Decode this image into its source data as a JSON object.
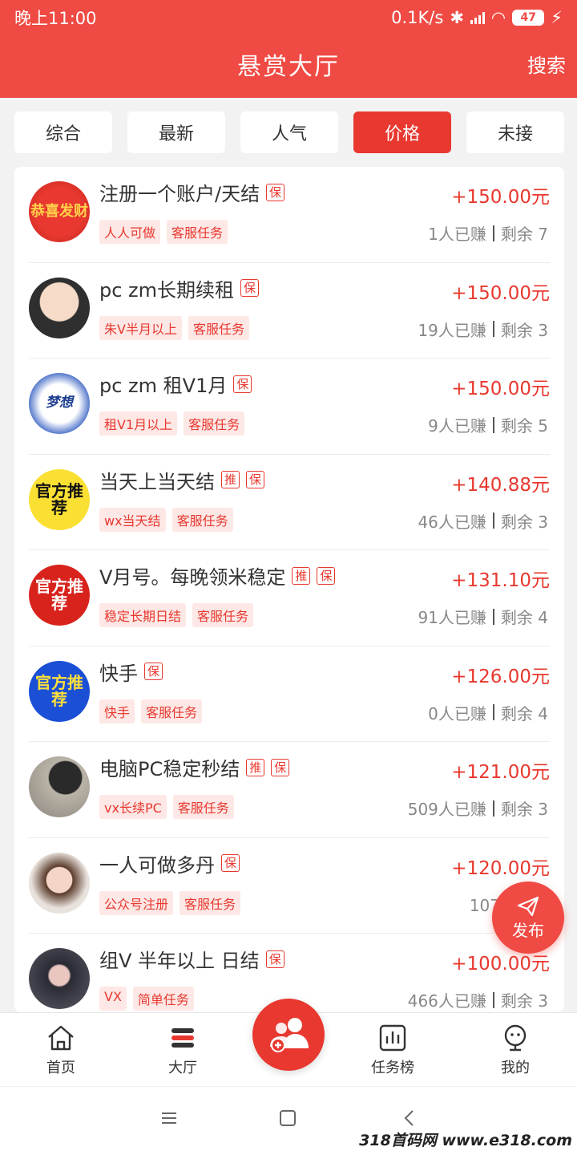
{
  "status": {
    "time": "晚上11:00",
    "speed": "0.1K/s",
    "battery": "47"
  },
  "header": {
    "title": "悬赏大厅",
    "search_label": "搜索",
    "accent": "#ef4a43"
  },
  "tabs": [
    {
      "label": "综合",
      "active": false
    },
    {
      "label": "最新",
      "active": false
    },
    {
      "label": "人气",
      "active": false
    },
    {
      "label": "价格",
      "active": true
    },
    {
      "label": "未接",
      "active": false
    }
  ],
  "tasks": [
    {
      "title": "注册一个账户/天结",
      "badges": [
        "保"
      ],
      "price": "+150.00元",
      "tags": [
        "人人可做",
        "客服任务"
      ],
      "earned": "1人已赚",
      "remaining": "剩余 7",
      "avatar_text": "恭喜发财",
      "avatar_style": "lucky"
    },
    {
      "title": "pc zm长期续租",
      "badges": [
        "保"
      ],
      "price": "+150.00元",
      "tags": [
        "朱V半月以上",
        "客服任务"
      ],
      "earned": "19人已赚",
      "remaining": "剩余 3",
      "avatar_text": "",
      "avatar_style": "anime"
    },
    {
      "title": "pc zm 租V1月",
      "badges": [
        "保"
      ],
      "price": "+150.00元",
      "tags": [
        "租V1月以上",
        "客服任务"
      ],
      "earned": "9人已赚",
      "remaining": "剩余 5",
      "avatar_text": "梦想",
      "avatar_style": "dream"
    },
    {
      "title": "当天上当天结",
      "badges": [
        "推",
        "保"
      ],
      "price": "+140.88元",
      "tags": [
        "wx当天结",
        "客服任务"
      ],
      "earned": "46人已赚",
      "remaining": "剩余 3",
      "avatar_text": "官方推荐",
      "avatar_style": "official-yellow"
    },
    {
      "title": "V月号。每晚领米稳定",
      "badges": [
        "推",
        "保"
      ],
      "price": "+131.10元",
      "tags": [
        "稳定长期日结",
        "客服任务"
      ],
      "earned": "91人已赚",
      "remaining": "剩余 4",
      "avatar_text": "官方推荐",
      "avatar_style": "official-red"
    },
    {
      "title": "快手",
      "badges": [
        "保"
      ],
      "price": "+126.00元",
      "tags": [
        "快手",
        "客服任务"
      ],
      "earned": "0人已赚",
      "remaining": "剩余 4",
      "avatar_text": "官方推荐",
      "avatar_style": "official-blue"
    },
    {
      "title": "电脑PC稳定秒结",
      "badges": [
        "推",
        "保"
      ],
      "price": "+121.00元",
      "tags": [
        "vx长续PC",
        "客服任务"
      ],
      "earned": "509人已赚",
      "remaining": "剩余 3",
      "avatar_text": "",
      "avatar_style": "photo-man"
    },
    {
      "title": "一人可做多丹",
      "badges": [
        "保"
      ],
      "price": "+120.00元",
      "tags": [
        "公众号注册",
        "客服任务"
      ],
      "earned": "107人已赚",
      "remaining": "",
      "avatar_text": "",
      "avatar_style": "photo-girl"
    },
    {
      "title": "组V 半年以上 日结",
      "badges": [
        "保"
      ],
      "price": "+100.00元",
      "tags": [
        "VX",
        "简单任务"
      ],
      "earned": "466人已赚",
      "remaining": "剩余 3",
      "avatar_text": "",
      "avatar_style": "photo-dark"
    }
  ],
  "fab": {
    "label": "发布",
    "icon": "paper-plane-icon"
  },
  "bottom_nav": [
    {
      "label": "首页",
      "icon": "home-icon"
    },
    {
      "label": "大厅",
      "icon": "hall-icon"
    },
    {
      "label": "任务榜",
      "icon": "chart-icon"
    },
    {
      "label": "我的",
      "icon": "profile-icon"
    }
  ],
  "center_button": {
    "icon": "users-add-icon"
  },
  "watermark": "318首码网 www.e318.com"
}
